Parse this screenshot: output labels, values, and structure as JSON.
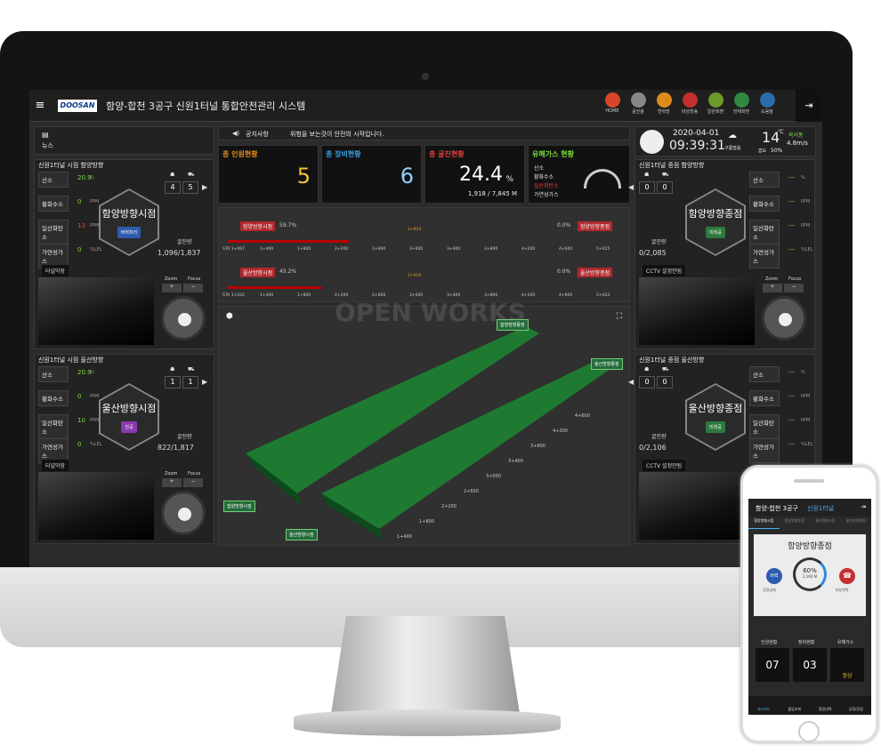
{
  "header": {
    "menu_icon": "≡",
    "logo": "DOOSAN",
    "title": "함양-합천 3공구 신원1터널 통합안전관리 시스템",
    "nav": [
      {
        "label": "HOME",
        "icon": "home-icon",
        "color": "#d9452b"
      },
      {
        "label": "굴진율",
        "icon": "list-icon",
        "color": "#888"
      },
      {
        "label": "연락망",
        "icon": "book-icon",
        "color": "#e08a1c"
      },
      {
        "label": "비상방송",
        "icon": "mic-icon",
        "color": "#c42f2f"
      },
      {
        "label": "일반화면",
        "icon": "grid-icon",
        "color": "#6a9a2a"
      },
      {
        "label": "전체화면",
        "icon": "fullscreen-icon",
        "color": "#2e8a3e"
      },
      {
        "label": "도움말",
        "icon": "help-icon",
        "color": "#2e6aae"
      }
    ],
    "exit_icon": "⇥"
  },
  "news": {
    "label": "뉴스"
  },
  "notice": {
    "label": "공지사항",
    "text": "위험을 보는것이 안전의 시작입니다."
  },
  "clock": {
    "date": "2020-04-01",
    "time": "09:39:31",
    "weather": "구름많음",
    "temp": "14",
    "unit": "℃",
    "wind_dir": "북서풍",
    "wind": "4.8m/s",
    "hum_label": "습도",
    "hum": "50%"
  },
  "stats": {
    "people_title": "총 인원현황",
    "people": "5",
    "equip_title": "총 장비현황",
    "equip": "6",
    "dig_title": "총 굴진현황",
    "dig": "24.4",
    "dig_unit": "%",
    "dig_sub": "1,918 / 7,845 M",
    "gas_title": "유해가스 현황",
    "gas_items": [
      "산소",
      "황화수소",
      "일산화탄소",
      "가연성가스"
    ]
  },
  "progress": {
    "rows": [
      {
        "left": "함양방향시점",
        "lpct": "59.7%",
        "marker": "2+924",
        "rpct": "0.0%",
        "right": "함양방향종점",
        "ticks": [
          "STA 1+067",
          "1+400",
          "1+800",
          "2+200",
          "2+600",
          "3+000",
          "3+400",
          "3+800",
          "4+200",
          "4+600",
          "5+015"
        ],
        "fill": 0.31
      },
      {
        "left": "울산방향시점",
        "lpct": "45.2%",
        "marker": "2+919",
        "rpct": "0.0%",
        "right": "울산방향종점",
        "ticks": [
          "STA 1+102",
          "1+400",
          "1+800",
          "2+200",
          "2+600",
          "3+000",
          "3+400",
          "3+800",
          "4+200",
          "4+600",
          "5+024"
        ],
        "fill": 0.24
      }
    ]
  },
  "map": {
    "labels": [
      "함양방향종점",
      "울산방향종점",
      "함양방향시점",
      "울산방향시점"
    ],
    "sta": [
      "4+600",
      "4+200",
      "3+800",
      "3+400",
      "3+000",
      "2+600",
      "2+200",
      "1+800",
      "1+400"
    ],
    "watermark": "OPEN WORKS"
  },
  "left_panels": [
    {
      "title": "신원1터널 시점 함양방향",
      "gas": [
        {
          "l": "산소",
          "v": "20.9",
          "u": "%"
        },
        {
          "l": "황화수소",
          "v": "0",
          "u": "PPM"
        },
        {
          "l": "일산화탄소",
          "v": "13",
          "u": "PPM"
        },
        {
          "l": "가연성가스",
          "v": "0",
          "u": "%LEL"
        }
      ],
      "hex_name": "함양방향시점",
      "hex_badge": "버력처리",
      "badge_color": "#2e5cae",
      "people": "4",
      "equip": "5",
      "dig_label": "굴진량",
      "dig": "1,096/1,837",
      "cam_label": "터널막장",
      "zoom": "Zoom",
      "focus": "Focus"
    },
    {
      "title": "신원1터널 시점 울산방향",
      "gas": [
        {
          "l": "산소",
          "v": "20.9",
          "u": "%"
        },
        {
          "l": "황화수소",
          "v": "0",
          "u": "PPM"
        },
        {
          "l": "일산화탄소",
          "v": "10",
          "u": "PPM"
        },
        {
          "l": "가연성가스",
          "v": "0",
          "u": "%LEL"
        }
      ],
      "hex_name": "울산방향시점",
      "hex_badge": "천공",
      "badge_color": "#8a3ab0",
      "people": "1",
      "equip": "1",
      "dig_label": "굴진량",
      "dig": "822/1,817",
      "cam_label": "터널막장",
      "zoom": "Zoom",
      "focus": "Focus"
    }
  ],
  "right_panels": [
    {
      "title": "신원1터널 종점 함양방향",
      "gas": [
        {
          "l": "산소",
          "v": "---",
          "u": "%"
        },
        {
          "l": "황화수소",
          "v": "---",
          "u": "PPM"
        },
        {
          "l": "일산화탄소",
          "v": "---",
          "u": "PPM"
        },
        {
          "l": "가연성가스",
          "v": "---",
          "u": "%LEL"
        }
      ],
      "hex_name": "함양방향종점",
      "hex_badge": "미착공",
      "badge_color": "#2e7a3e",
      "people": "0",
      "equip": "0",
      "dig_label": "굴진량",
      "dig": "0/2,085",
      "cam_label": "CCTV 설정안됨",
      "zoom": "Zoom",
      "focus": "Focus"
    },
    {
      "title": "신원1터널 종점 울산방향",
      "gas": [
        {
          "l": "산소",
          "v": "---",
          "u": "%"
        },
        {
          "l": "황화수소",
          "v": "---",
          "u": "PPM"
        },
        {
          "l": "일산화탄소",
          "v": "---",
          "u": "PPM"
        },
        {
          "l": "가연성가스",
          "v": "---",
          "u": "%LEL"
        }
      ],
      "hex_name": "울산방향종점",
      "hex_badge": "미착공",
      "badge_color": "#2e7a3e",
      "people": "0",
      "equip": "0",
      "dig_label": "굴진량",
      "dig": "0/2,106",
      "cam_label": "CCTV 설정안됨",
      "zoom": "Zoom",
      "focus": "Focus"
    }
  ],
  "phone": {
    "title": "함양-합천 3공구",
    "title2": "신원1터널",
    "tabs": [
      "함양방향시점",
      "함양방향종점",
      "울산방향시점",
      "울산방향종점"
    ],
    "card_title": "함양방향종점",
    "btn_left": "버력",
    "btn_left_sub": "공정상태",
    "pct": "60%",
    "dist": "2,160 M",
    "btn_right_sub": "비상연락",
    "col_labels": [
      "인원현황",
      "장비현황",
      "유해가스"
    ],
    "people": "07",
    "equip": "03",
    "gas": "정상",
    "bottom": [
      "대시보드",
      "출입조회",
      "알림내역",
      "공정/공법"
    ]
  }
}
